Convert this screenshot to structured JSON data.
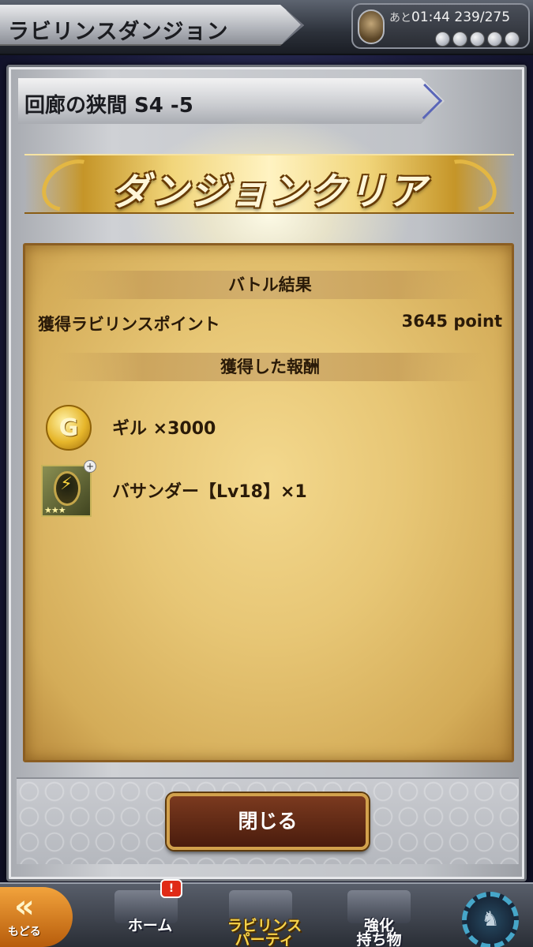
{
  "header": {
    "title": "ラビリンスダンジョン",
    "stamina_prefix": "あと",
    "stamina_timer": "01:44",
    "stamina_value": "239/275"
  },
  "dialog": {
    "stage_title": "回廊の狭間 S4 -5",
    "banner": "ダンジョンクリア",
    "battle_result_header": "バトル結果",
    "labyrinth_point_label": "獲得ラビリンスポイント",
    "labyrinth_point_value": "3645 point",
    "rewards_header": "獲得した報酬",
    "rewards": [
      {
        "icon": "gil-coin-icon",
        "icon_glyph": "G",
        "text": "ギル ×3000"
      },
      {
        "icon": "materia-icon",
        "text": "バサンダー【Lv18】×1"
      }
    ],
    "close_label": "閉じる"
  },
  "nav": {
    "back_label": "もどる",
    "home_label": "ホーム",
    "home_badge": "!",
    "party_label_1": "ラビリンス",
    "party_label_2": "パーティ",
    "items_label_1": "強化",
    "items_label_2": "持ち物"
  },
  "colors": {
    "accent_gold": "#e3b743",
    "parchment": "#e7c675",
    "close_button": "#5e2914",
    "nav_back": "#f2a33c"
  }
}
